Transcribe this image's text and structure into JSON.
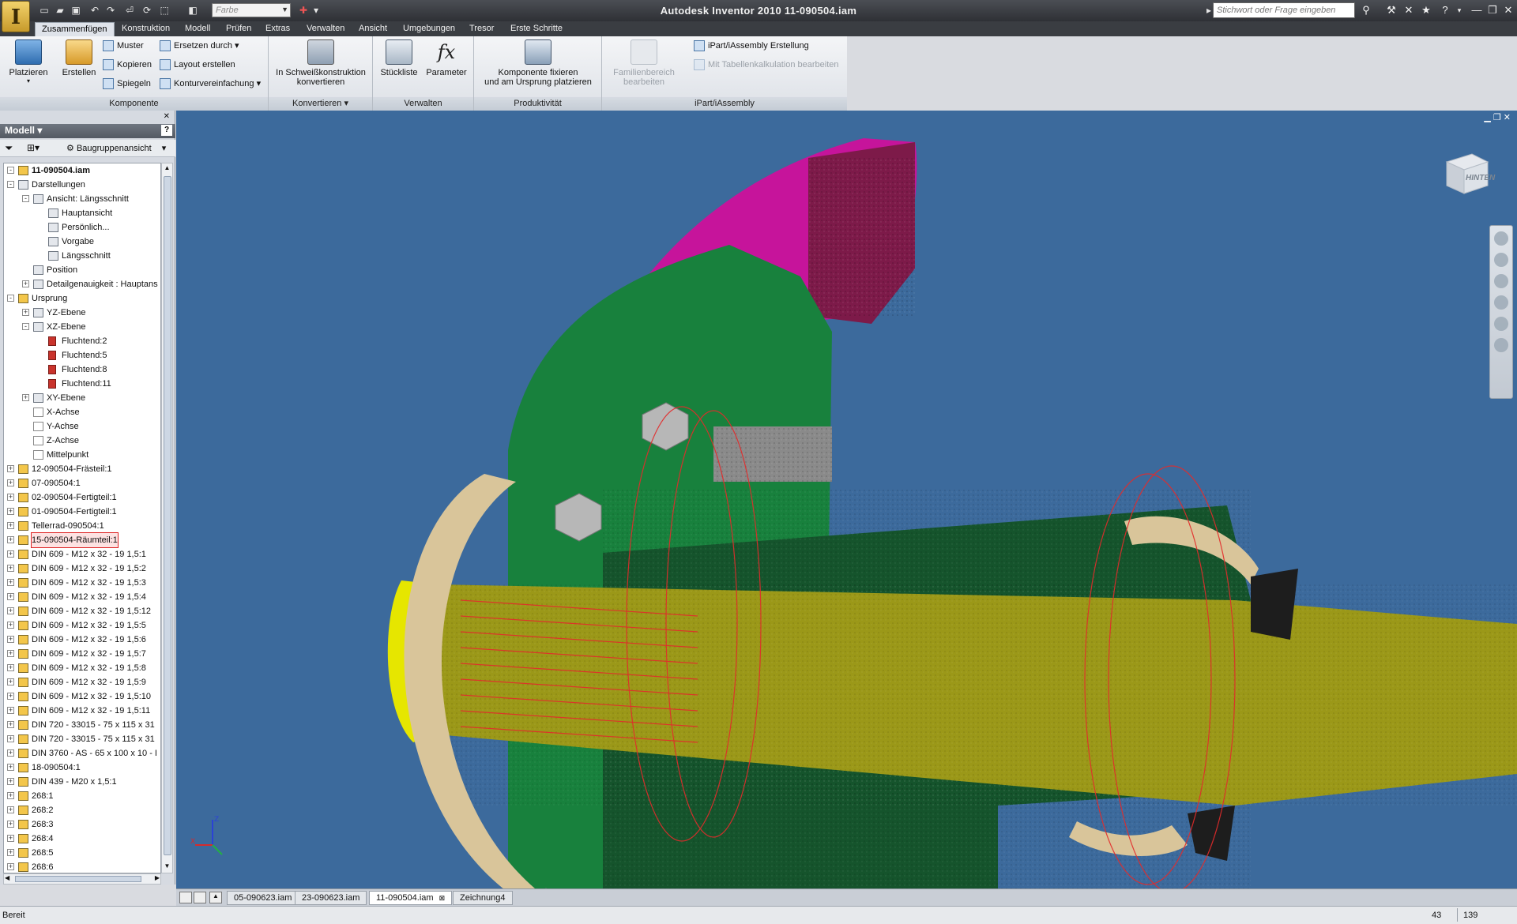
{
  "window": {
    "title": "Autodesk Inventor 2010    11-090504.iam",
    "color_dropdown": "Farbe",
    "search_placeholder": "Stichwort oder Frage eingeben"
  },
  "tabs": [
    "Zusammenfügen",
    "Konstruktion",
    "Modell",
    "Prüfen",
    "Extras",
    "Verwalten",
    "Ansicht",
    "Umgebungen",
    "Tresor",
    "Erste Schritte"
  ],
  "ribbon": {
    "komponente": {
      "title": "Komponente",
      "platzieren": "Platzieren",
      "erstellen": "Erstellen",
      "muster": "Muster",
      "kopieren": "Kopieren",
      "spiegeln": "Spiegeln",
      "ersetzen": "Ersetzen durch",
      "layout": "Layout erstellen",
      "kontur": "Konturvereinfachung"
    },
    "konvertieren": {
      "title": "Konvertieren",
      "line1": "In Schweißkonstruktion",
      "line2": "konvertieren"
    },
    "verwalten": {
      "title": "Verwalten",
      "stueckliste": "Stückliste",
      "parameter": "Parameter"
    },
    "produktivitaet": {
      "title": "Produktivität",
      "line1": "Komponente fixieren",
      "line2": "und am Ursprung platzieren"
    },
    "ipart": {
      "title": "iPart/iAssembly",
      "familien1": "Familienbereich",
      "familien2": "bearbeiten",
      "erstellung": "iPart/iAssembly Erstellung",
      "tabellen": "Mit Tabellenkalkulation bearbeiten"
    }
  },
  "browser": {
    "header": "Modell",
    "view_dropdown": "Baugruppenansicht",
    "tree": [
      {
        "label": "11-090504.iam",
        "level": 0,
        "exp": "-",
        "icon": "assembly"
      },
      {
        "label": "Darstellungen",
        "level": 0,
        "exp": "-",
        "icon": "sheet"
      },
      {
        "label": "Ansicht: Längsschnitt",
        "level": 1,
        "exp": "-",
        "icon": "sheet"
      },
      {
        "label": "Hauptansicht",
        "level": 2,
        "exp": "",
        "icon": "sheet"
      },
      {
        "label": "Persönlich...",
        "level": 2,
        "exp": "",
        "icon": "sheet"
      },
      {
        "label": "Vorgabe",
        "level": 2,
        "exp": "",
        "icon": "sheet"
      },
      {
        "label": "Längsschnitt",
        "level": 2,
        "exp": "",
        "icon": "sheet"
      },
      {
        "label": "Position",
        "level": 1,
        "exp": "",
        "icon": "sheet"
      },
      {
        "label": "Detailgenauigkeit : Hauptans",
        "level": 1,
        "exp": "+",
        "icon": "sheet"
      },
      {
        "label": "Ursprung",
        "level": 0,
        "exp": "-",
        "icon": "folder"
      },
      {
        "label": "YZ-Ebene",
        "level": 1,
        "exp": "+",
        "icon": "sheet"
      },
      {
        "label": "XZ-Ebene",
        "level": 1,
        "exp": "-",
        "icon": "sheet"
      },
      {
        "label": "Fluchtend:2",
        "level": 2,
        "exp": "",
        "icon": "red"
      },
      {
        "label": "Fluchtend:5",
        "level": 2,
        "exp": "",
        "icon": "red"
      },
      {
        "label": "Fluchtend:8",
        "level": 2,
        "exp": "",
        "icon": "red"
      },
      {
        "label": "Fluchtend:11",
        "level": 2,
        "exp": "",
        "icon": "red"
      },
      {
        "label": "XY-Ebene",
        "level": 1,
        "exp": "+",
        "icon": "sheet"
      },
      {
        "label": "X-Achse",
        "level": 1,
        "exp": "",
        "icon": "axis"
      },
      {
        "label": "Y-Achse",
        "level": 1,
        "exp": "",
        "icon": "axis"
      },
      {
        "label": "Z-Achse",
        "level": 1,
        "exp": "",
        "icon": "axis"
      },
      {
        "label": "Mittelpunkt",
        "level": 1,
        "exp": "",
        "icon": "axis"
      },
      {
        "label": "12-090504-Frästeil:1",
        "level": 0,
        "exp": "+",
        "icon": "part"
      },
      {
        "label": "07-090504:1",
        "level": 0,
        "exp": "+",
        "icon": "part"
      },
      {
        "label": "02-090504-Fertigteil:1",
        "level": 0,
        "exp": "+",
        "icon": "part"
      },
      {
        "label": "01-090504-Fertigteil:1",
        "level": 0,
        "exp": "+",
        "icon": "part"
      },
      {
        "label": "Tellerrad-090504:1",
        "level": 0,
        "exp": "+",
        "icon": "part"
      },
      {
        "label": "15-090504-Räumteil:1",
        "level": 0,
        "exp": "+",
        "icon": "part"
      },
      {
        "label": "DIN 609 - M12 x 32 - 19 1,5:1",
        "level": 0,
        "exp": "+",
        "icon": "part"
      },
      {
        "label": "DIN 609 - M12 x 32 - 19 1,5:2",
        "level": 0,
        "exp": "+",
        "icon": "part"
      },
      {
        "label": "DIN 609 - M12 x 32 - 19 1,5:3",
        "level": 0,
        "exp": "+",
        "icon": "part"
      },
      {
        "label": "DIN 609 - M12 x 32 - 19 1,5:4",
        "level": 0,
        "exp": "+",
        "icon": "part"
      },
      {
        "label": "DIN 609 - M12 x 32 - 19 1,5:12",
        "level": 0,
        "exp": "+",
        "icon": "part"
      },
      {
        "label": "DIN 609 - M12 x 32 - 19 1,5:5",
        "level": 0,
        "exp": "+",
        "icon": "part"
      },
      {
        "label": "DIN 609 - M12 x 32 - 19 1,5:6",
        "level": 0,
        "exp": "+",
        "icon": "part"
      },
      {
        "label": "DIN 609 - M12 x 32 - 19 1,5:7",
        "level": 0,
        "exp": "+",
        "icon": "part"
      },
      {
        "label": "DIN 609 - M12 x 32 - 19 1,5:8",
        "level": 0,
        "exp": "+",
        "icon": "part"
      },
      {
        "label": "DIN 609 - M12 x 32 - 19 1,5:9",
        "level": 0,
        "exp": "+",
        "icon": "part"
      },
      {
        "label": "DIN 609 - M12 x 32 - 19 1,5:10",
        "level": 0,
        "exp": "+",
        "icon": "part"
      },
      {
        "label": "DIN 609 - M12 x 32 - 19 1,5:11",
        "level": 0,
        "exp": "+",
        "icon": "part"
      },
      {
        "label": "DIN 720 - 33015 - 75 x 115 x 31",
        "level": 0,
        "exp": "+",
        "icon": "part"
      },
      {
        "label": "DIN 720 - 33015 - 75 x 115 x 31",
        "level": 0,
        "exp": "+",
        "icon": "part"
      },
      {
        "label": "DIN 3760 - AS - 65 x 100 x 10 - I",
        "level": 0,
        "exp": "+",
        "icon": "part"
      },
      {
        "label": "18-090504:1",
        "level": 0,
        "exp": "+",
        "icon": "assembly"
      },
      {
        "label": "DIN 439 - M20 x 1,5:1",
        "level": 0,
        "exp": "+",
        "icon": "part"
      },
      {
        "label": "268:1",
        "level": 0,
        "exp": "+",
        "icon": "part"
      },
      {
        "label": "268:2",
        "level": 0,
        "exp": "+",
        "icon": "part"
      },
      {
        "label": "268:3",
        "level": 0,
        "exp": "+",
        "icon": "part"
      },
      {
        "label": "268:4",
        "level": 0,
        "exp": "+",
        "icon": "part"
      },
      {
        "label": "268:5",
        "level": 0,
        "exp": "+",
        "icon": "part"
      },
      {
        "label": "268:6",
        "level": 0,
        "exp": "+",
        "icon": "part"
      }
    ]
  },
  "viewcube_label": "HINTEN",
  "doc_tabs": [
    "05-090623.iam",
    "23-090623.iam",
    "11-090504.iam",
    "Zeichnung4"
  ],
  "active_doc": "11-090504.iam",
  "status": {
    "text": "Bereit",
    "value1": "43",
    "value2": "139"
  }
}
